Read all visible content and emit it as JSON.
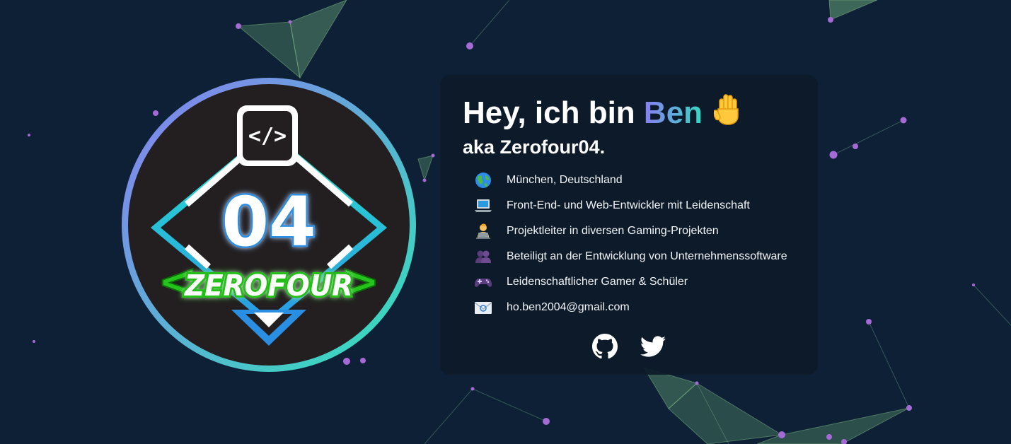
{
  "profile": {
    "greeting": "Hey, ich bin",
    "name": "Ben",
    "alias": "aka Zerofour04.",
    "wave_icon": "raised-hand-icon"
  },
  "logo": {
    "number": "04",
    "wordmark": "ZEROFOUR",
    "code_glyph": "</>"
  },
  "info_items": [
    {
      "icon": "globe-icon",
      "text": "München, Deutschland"
    },
    {
      "icon": "laptop-icon",
      "text": "Front-End- und Web-Entwickler mit Leidenschaft"
    },
    {
      "icon": "technologist-icon",
      "text": "Projektleiter in diversen Gaming-Projekten"
    },
    {
      "icon": "people-icon",
      "text": "Beteiligt an der Entwicklung von Unternehmenssoftware"
    },
    {
      "icon": "gamepad-icon",
      "text": "Leidenschaftlicher Gamer & Schüler"
    },
    {
      "icon": "email-icon",
      "text": "ho.ben2004@gmail.com"
    }
  ],
  "socials": [
    {
      "icon": "github-icon"
    },
    {
      "icon": "twitter-icon"
    }
  ],
  "colors": {
    "background": "#0d2036",
    "card": "#0c1a28",
    "accent_purple": "#8a7df2",
    "accent_teal": "#37d8c4",
    "node": "#a56ad6",
    "wordmark_green": "#24c41a"
  }
}
